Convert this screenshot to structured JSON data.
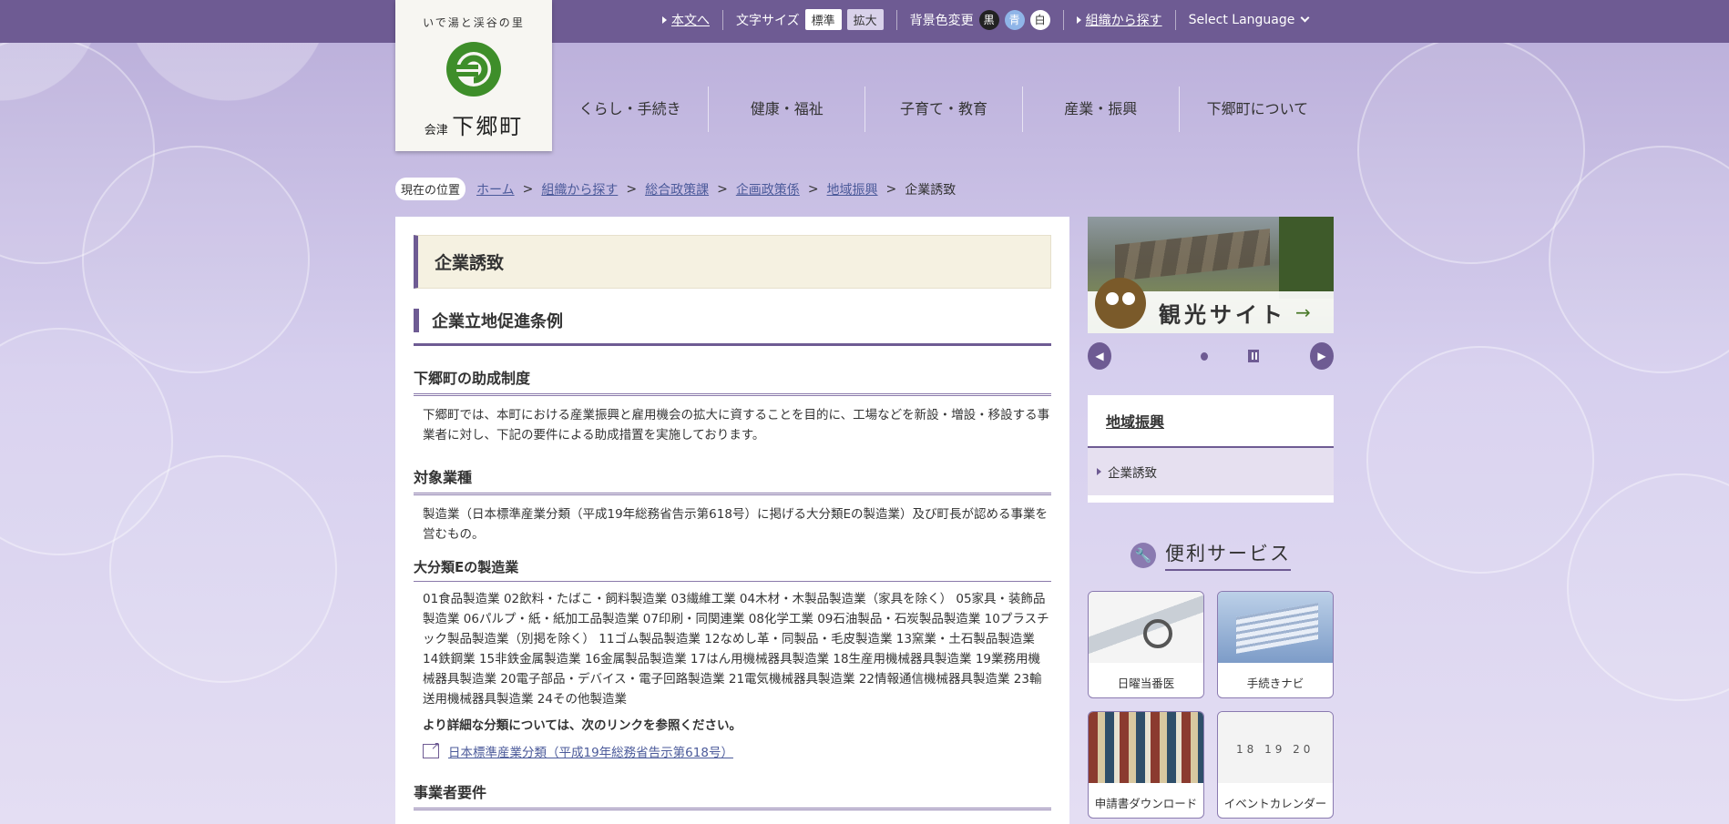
{
  "topbar": {
    "skip_link": "本文へ",
    "font_size_label": "文字サイズ",
    "font_size_standard": "標準",
    "font_size_large": "拡大",
    "bg_color_label": "背景色変更",
    "bg_black": "黒",
    "bg_blue": "青",
    "bg_white": "白",
    "org_search": "組織から探す",
    "language": "Select Language"
  },
  "logo": {
    "tagline": "いで湯と渓谷の里",
    "town_prefix": "会津",
    "town_name": "下郷町"
  },
  "global_nav": [
    {
      "label": "くらし・手続き"
    },
    {
      "label": "健康・福祉"
    },
    {
      "label": "子育て・教育"
    },
    {
      "label": "産業・振興"
    },
    {
      "label": "下郷町について"
    }
  ],
  "breadcrumb": {
    "label": "現在の位置",
    "items": [
      {
        "label": "ホーム"
      },
      {
        "label": "組織から探す"
      },
      {
        "label": "総合政策課"
      },
      {
        "label": "企画政策係"
      },
      {
        "label": "地域振興"
      }
    ],
    "current": "企業誘致"
  },
  "main": {
    "page_title": "企業誘致",
    "section_title": "企業立地促進条例",
    "subsidy": {
      "heading": "下郷町の助成制度",
      "text": "下郷町では、本町における産業振興と雇用機会の拡大に資することを目的に、工場などを新設・増設・移設する事業者に対し、下記の要件による助成措置を実施しております。"
    },
    "target": {
      "heading": "対象業種",
      "text": "製造業（日本標準産業分類（平成19年総務省告示第618号）に掲げる大分類Eの製造業）及び町長が認める事業を営むもの。"
    },
    "category_e": {
      "heading": "大分類Eの製造業",
      "text": "01食品製造業 02飲料・たばこ・飼料製造業 03繊維工業 04木材・木製品製造業（家具を除く） 05家具・装飾品製造業 06パルプ・紙・紙加工品製造業 07印刷・同関連業 08化学工業 09石油製品・石炭製品製造業 10プラスチック製品製造業（別掲を除く） 11ゴム製品製造業 12なめし革・同製品・毛皮製造業 13窯業・土石製品製造業 14鉄鋼業 15非鉄金属製造業 16金属製品製造業 17はん用機械器具製造業 18生産用機械器具製造業 19業務用機械器具製造業 20電子部品・デバイス・電子回路製造業 21電気機械器具製造業 22情報通信機械器具製造業 23輸送用機械器具製造業 24その他製造業",
      "note": "より詳細な分類については、次のリンクを参照ください。",
      "link": "日本標準産業分類（平成19年総務省告示第618号）"
    },
    "requirements_heading": "事業者要件"
  },
  "sidebar": {
    "banner_text": "観光サイト",
    "local_nav_heading": "地域振興",
    "local_nav_items": [
      {
        "label": "企業誘致"
      }
    ],
    "services_title": "便利サービス",
    "services": [
      {
        "label": "日曜当番医"
      },
      {
        "label": "手続きナビ"
      },
      {
        "label": "申請書ダウンロード"
      },
      {
        "label": "イベントカレンダー"
      }
    ]
  },
  "colors": {
    "accent": "#6e5b93",
    "link": "#4b5a9a",
    "title_bg": "#f5f1e1"
  }
}
